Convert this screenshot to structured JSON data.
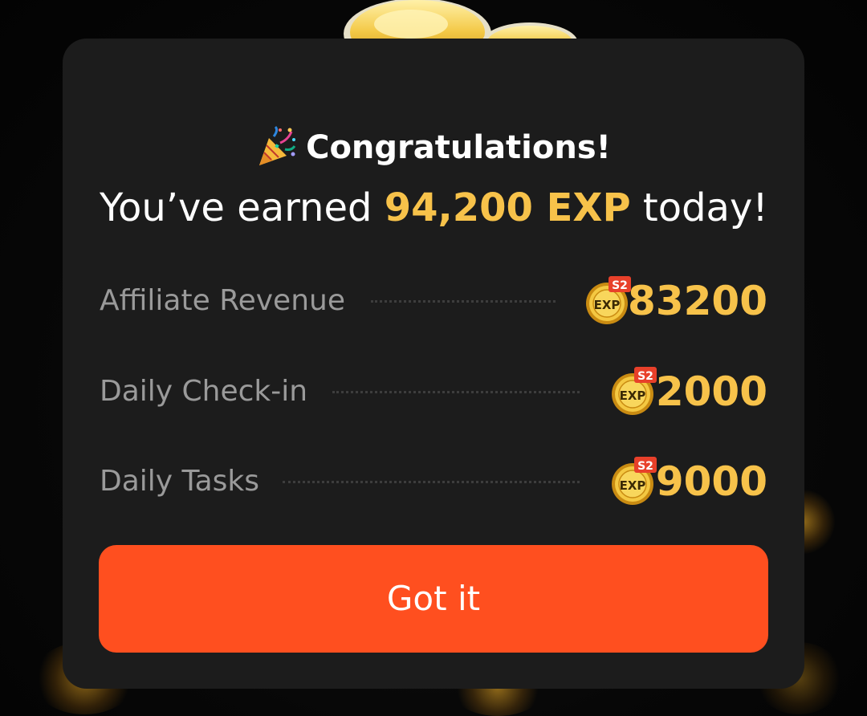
{
  "dialog": {
    "title": "Congratulations!",
    "title_icon": "party-popper-icon",
    "headline_prefix": "You’ve earned ",
    "headline_highlight": "94,200 EXP",
    "headline_suffix": " today!",
    "rows": [
      {
        "label": "Affiliate Revenue",
        "amount": "83200",
        "badge_tag": "S2",
        "badge_text": "EXP"
      },
      {
        "label": "Daily Check-in",
        "amount": "2000",
        "badge_tag": "S2",
        "badge_text": "EXP"
      },
      {
        "label": "Daily Tasks",
        "amount": "9000",
        "badge_tag": "S2",
        "badge_text": "EXP"
      }
    ],
    "button_label": "Got it"
  },
  "colors": {
    "dialog_bg": "#1c1c1c",
    "accent_gold": "#f7c24a",
    "button_orange": "#ff4f1f",
    "label_gray": "#9a9a9a",
    "badge_red": "#e8402a"
  }
}
